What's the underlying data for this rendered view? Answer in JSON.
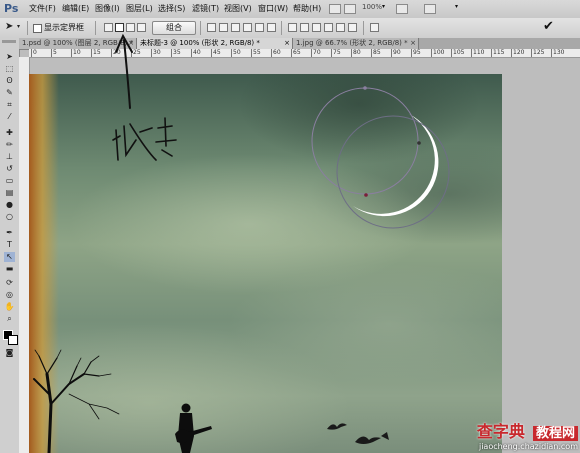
{
  "app": {
    "logo": "Ps"
  },
  "menu": {
    "items": [
      "文件(F)",
      "编辑(E)",
      "图像(I)",
      "图层(L)",
      "选择(S)",
      "滤镜(T)",
      "视图(V)",
      "窗口(W)",
      "帮助(H)"
    ],
    "zoom_value": "100%"
  },
  "options": {
    "show_bounding_box": "显示定界框",
    "combine_button": "组合"
  },
  "tabs": [
    {
      "label": "1.psd @ 100% (图层 2, RGB/8) *",
      "close": "×"
    },
    {
      "label": "未标题-3 @ 100% (形状 2, RGB/8) *",
      "close": "×"
    },
    {
      "label": "1.jpg @ 66.7% (形状 2, RGB/8) *",
      "close": "×"
    }
  ],
  "annotation": {
    "handwritten_text": "减去"
  },
  "ruler": {
    "ticks": [
      "0",
      "5",
      "10",
      "15",
      "20",
      "25",
      "30",
      "35",
      "40",
      "45",
      "50",
      "55",
      "60",
      "65",
      "70",
      "75",
      "80",
      "85",
      "90",
      "95",
      "100",
      "105",
      "110",
      "115",
      "120",
      "125",
      "130"
    ]
  },
  "watermark": {
    "brand": "查字典",
    "sub": "教程网",
    "url": "jiaocheng.chazidian.com"
  },
  "colors": {
    "accent": "#1f4f8f",
    "moon": "#ffffff",
    "sky": "#7a927c",
    "watermark_red": "#c8282d"
  }
}
